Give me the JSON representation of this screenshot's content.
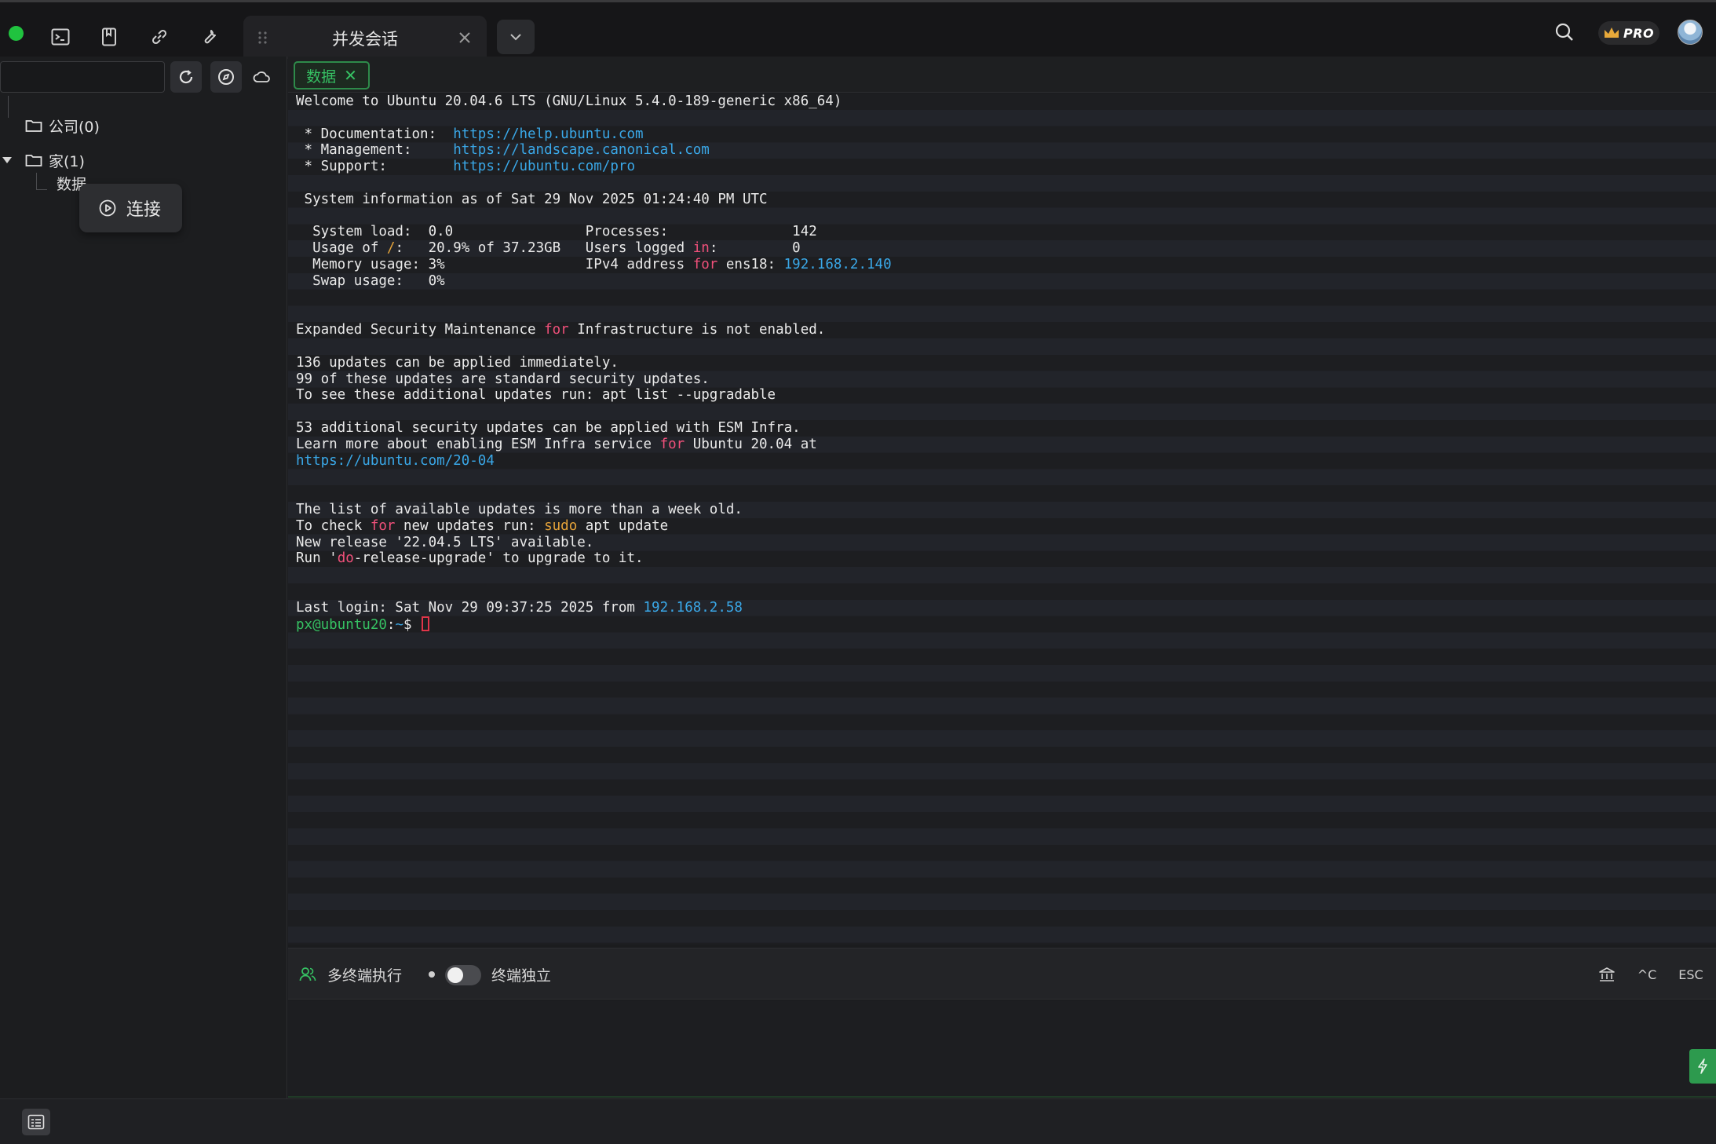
{
  "topbar": {
    "status": "connected",
    "icons": [
      "terminal-icon",
      "bookmark-icon",
      "link-icon",
      "wrench-icon"
    ],
    "tab_title": "并发会话",
    "pro_label": "PRO",
    "icon_colors": {
      "status_dot": "#20c33f"
    }
  },
  "sidebar": {
    "search_placeholder": "",
    "tree": [
      {
        "label": "公司(0)",
        "expanded": false
      },
      {
        "label": "家(1)",
        "expanded": true,
        "children": [
          {
            "label": "数据"
          }
        ]
      }
    ],
    "context_popup": {
      "label": "连接"
    }
  },
  "session_tab": {
    "label": "数据",
    "close": "✕",
    "accent": "#36c163"
  },
  "terminal": {
    "lines": [
      "Welcome to Ubuntu 20.04.6 LTS (GNU/Linux 5.4.0-189-generic x86_64)",
      "",
      " * Documentation:  https://help.ubuntu.com",
      " * Management:     https://landscape.canonical.com",
      " * Support:        https://ubuntu.com/pro",
      "",
      " System information as of Sat 29 Nov 2025 01:24:40 PM UTC",
      "",
      "  System load:  0.0                Processes:               142",
      "  Usage of /:   20.9% of 37.23GB   Users logged in:         0",
      "  Memory usage: 3%                 IPv4 address for ens18: 192.168.2.140",
      "  Swap usage:   0%",
      "",
      "",
      "Expanded Security Maintenance for Infrastructure is not enabled.",
      "",
      "136 updates can be applied immediately.",
      "99 of these updates are standard security updates.",
      "To see these additional updates run: apt list --upgradable",
      "",
      "53 additional security updates can be applied with ESM Infra.",
      "Learn more about enabling ESM Infra service for Ubuntu 20.04 at",
      "https://ubuntu.com/20-04",
      "",
      "",
      "The list of available updates is more than a week old.",
      "To check for new updates run: sudo apt update",
      "New release '22.04.5 LTS' available.",
      "Run 'do-release-upgrade' to upgrade to it.",
      "",
      "",
      "Last login: Sat Nov 29 09:37:25 2025 from 192.168.2.58",
      "px@ubuntu20:~$ "
    ],
    "colors": {
      "url": "#3aa8e8",
      "keyword": "#f0507a",
      "string": "#e5a33a",
      "prompt": "#36c163"
    }
  },
  "exec_bar": {
    "multi_exec_label": "多终端执行",
    "independent_label": "终端独立",
    "toggle_on": false,
    "ctrl_c_label": "^C",
    "esc_label": "ESC"
  },
  "command_input": {
    "value": ""
  }
}
